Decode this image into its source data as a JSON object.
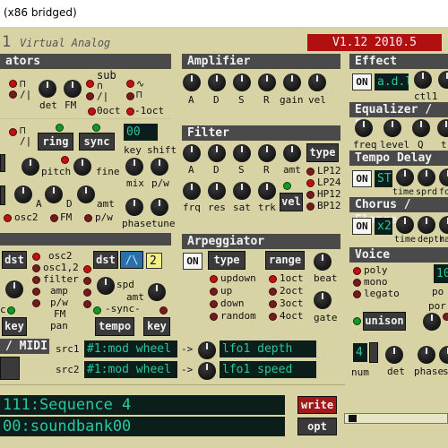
{
  "window_title": "(x86 bridged)",
  "header": {
    "name_partial": "1",
    "subtitle": "Virtual Analog",
    "version": "V1.12 2010.5"
  },
  "osc": {
    "title": "ators",
    "sub_label": "sub",
    "det": "det",
    "fm": "FM",
    "oct0": "0oct",
    "oct1": "-1oct",
    "ring": "ring",
    "sync": "sync",
    "pitch": "pitch",
    "fine": "fine",
    "key_value": "00",
    "key": "key",
    "shift": "shift",
    "mix": "mix",
    "pw": "p/w",
    "a": "A",
    "d": "D",
    "amt": "amt",
    "osc2": "osc2",
    "fm2": "FM",
    "pw2": "p/w",
    "phase": "phase",
    "tune": "tune"
  },
  "amp": {
    "title": "Amplifier",
    "a": "A",
    "d": "D",
    "s": "S",
    "r": "R",
    "gain": "gain",
    "vel": "vel"
  },
  "filter": {
    "title": "Filter",
    "a": "A",
    "d": "D",
    "s": "S",
    "r": "R",
    "amt": "amt",
    "type": "type",
    "frq": "frq",
    "res": "res",
    "sat": "sat",
    "trk": "trk",
    "vel": "vel",
    "types": [
      "LP12",
      "LP24",
      "HP12",
      "BP12"
    ]
  },
  "lfo": {
    "dst1": "dst",
    "dst2": "dst",
    "targets": [
      "osc2",
      "osc1,2",
      "filter",
      "amp",
      "p/w",
      "FM",
      "pan"
    ],
    "spd": "spd",
    "amt": "amt",
    "sync": "-sync-",
    "wave_value": "2",
    "key": "key",
    "tempo": "tempo",
    "key2": "key",
    "c_label": "c"
  },
  "arp": {
    "title": "Arpeggiator",
    "on": "ON",
    "type": "type",
    "range": "range",
    "modes": [
      "updown",
      "up",
      "down",
      "random"
    ],
    "octaves": [
      "1oct",
      "2oct",
      "3oct",
      "4oct"
    ],
    "beat": "beat",
    "gate": "gate"
  },
  "mod": {
    "title": "/ MIDI",
    "src1": "src1",
    "src2": "src2",
    "src1_value": "#1:mod wheel",
    "src2_value": "#1:mod wheel",
    "arrow": "->",
    "dst1_value": "lfo1 depth",
    "dst2_value": "lfo1 speed"
  },
  "effect": {
    "title": "Effect",
    "on": "ON",
    "type_value": "a.d.l",
    "ctl1": "ctl1"
  },
  "eq": {
    "title": "Equalizer / Pa",
    "freq": "freq",
    "level": "level",
    "q": "Q",
    "t": "t"
  },
  "delay": {
    "title": "Tempo Delay",
    "on": "ON",
    "st": "ST",
    "time": "time",
    "sprd": "sprd",
    "fo": "fo"
  },
  "chorus": {
    "title": "Chorus / Flange",
    "on": "ON",
    "x2": "x2",
    "time": "time",
    "depth": "depth",
    "rat": "rat"
  },
  "voice": {
    "title": "Voice",
    "modes": [
      "poly",
      "mono",
      "legato"
    ],
    "unison": "unison",
    "poly_value": "10",
    "po": "po",
    "por": "por",
    "num_value": "4",
    "num": "num",
    "det": "det",
    "phase": "phase",
    "s": "s"
  },
  "program": {
    "sequence": "111:Sequence 4",
    "bank": "00:soundbank00",
    "write": "write",
    "opt": "opt"
  }
}
